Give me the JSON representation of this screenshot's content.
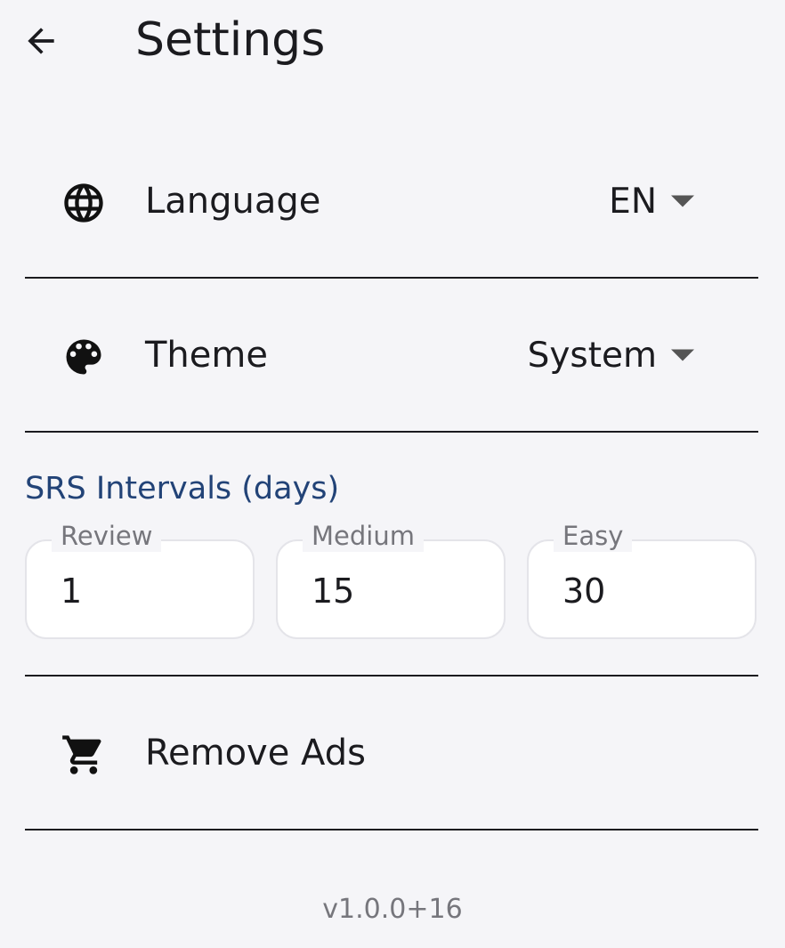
{
  "header": {
    "title": "Settings",
    "back_icon": "arrow-back-icon"
  },
  "settings": {
    "language": {
      "label": "Language",
      "value": "EN",
      "icon": "globe-icon"
    },
    "theme": {
      "label": "Theme",
      "value": "System",
      "icon": "palette-icon"
    },
    "srs": {
      "title": "SRS Intervals (days)",
      "fields": [
        {
          "label": "Review",
          "value": "1"
        },
        {
          "label": "Medium",
          "value": "15"
        },
        {
          "label": "Easy",
          "value": "30"
        }
      ]
    },
    "remove_ads": {
      "label": "Remove Ads",
      "icon": "cart-icon"
    }
  },
  "footer": {
    "version": "v1.0.0+16"
  },
  "colors": {
    "background": "#f5f5f8",
    "accent": "#224377",
    "text": "#1b1b1f",
    "muted": "#76767c"
  }
}
